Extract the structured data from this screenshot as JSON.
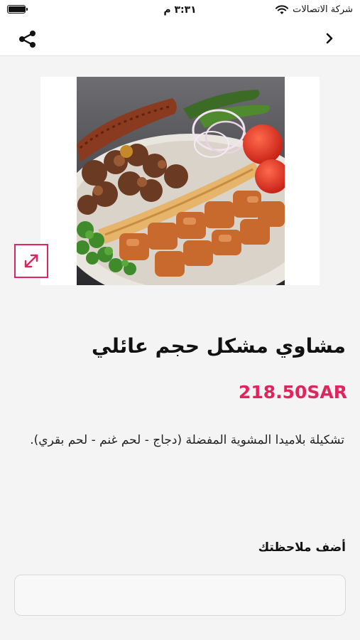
{
  "status_bar": {
    "time": "٣:٣١ م",
    "carrier": "شركة الاتصالات",
    "battery_level": 0.95
  },
  "nav": {
    "share_icon": "share-icon",
    "back_icon": "chevron-right-icon"
  },
  "product": {
    "expand_icon": "expand-arrows-icon",
    "title": "مشاوي مشكل حجم عائلي",
    "price": "218.50SAR",
    "description": "تشكيلة بلاميدا المشوية المفضلة (دجاج - لحم غنم - لحم بقري)."
  },
  "note": {
    "label": "أضف ملاحظتك",
    "value": "",
    "placeholder": ""
  },
  "colors": {
    "accent": "#e0245e",
    "background": "#f4f4f4"
  }
}
